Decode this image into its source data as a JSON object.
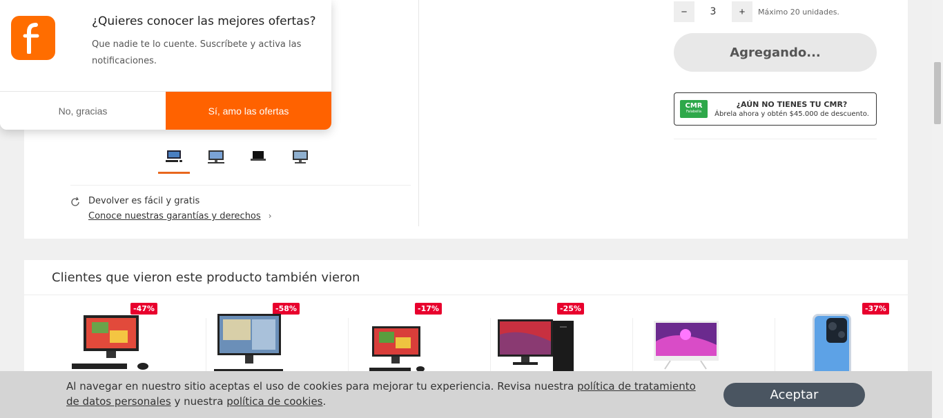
{
  "notification": {
    "title": "¿Quieres conocer las mejores ofertas?",
    "body": "Que nadie te lo cuente. Suscríbete y activa las notificaciones.",
    "decline_label": "No, gracias",
    "accept_label": "Sí, amo las ofertas",
    "brand_color": "#ff6200"
  },
  "product": {
    "thumbnails": [
      {
        "icon": "desktop-set-icon",
        "active": true
      },
      {
        "icon": "all-in-one-icon",
        "active": false
      },
      {
        "icon": "laptop-icon",
        "active": false
      },
      {
        "icon": "monitor-icon",
        "active": false
      }
    ],
    "return_title": "Devolver es fácil y gratis",
    "return_link": "Conoce nuestras garantías y derechos",
    "quantity": {
      "decrement": "−",
      "value": "3",
      "increment": "+",
      "max_text": "Máximo 20 unidades."
    },
    "add_button": "Agregando...",
    "cmr": {
      "logo": "CMR",
      "logo_sub": "Falabella",
      "title": "¿AÚN NO TIENES TU CMR?",
      "subtitle": "Ábrela ahora y obtén $45.000 de descuento."
    }
  },
  "recommendations": {
    "title": "Clientes que vieron este producto también vieron",
    "items": [
      {
        "discount": "-47%",
        "icon": "all-in-one-pc-icon"
      },
      {
        "discount": "-58%",
        "icon": "all-in-one-pc-icon"
      },
      {
        "discount": "-17%",
        "icon": "all-in-one-pc-icon"
      },
      {
        "discount": "-25%",
        "icon": "desktop-tower-icon"
      },
      {
        "discount": "",
        "icon": "all-in-one-pc-icon"
      },
      {
        "discount": "-37%",
        "icon": "smartphone-icon"
      }
    ],
    "badge_color": "#e8002d"
  },
  "cookie": {
    "text_1": "Al navegar en nuestro sitio aceptas el uso de cookies para mejorar tu experiencia. Revisa nuestra ",
    "link_1": "política de tratamiento de datos personales",
    "text_2": " y nuestra ",
    "link_2": "política de cookies",
    "text_3": ".",
    "accept_label": "Aceptar"
  }
}
